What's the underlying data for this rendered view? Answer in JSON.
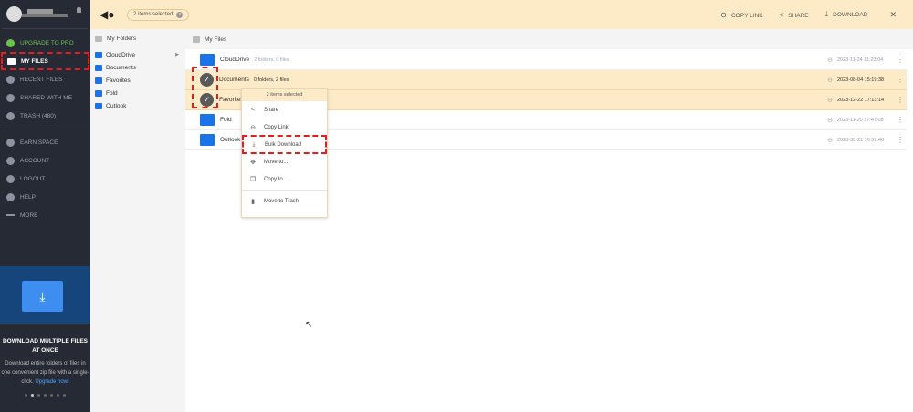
{
  "sidebar": {
    "nav": [
      {
        "label": "UPGRADE TO PRO",
        "icon": "pro-badge-icon"
      },
      {
        "label": "MY FILES",
        "icon": "folder-icon"
      },
      {
        "label": "RECENT FILES",
        "icon": "clock-icon"
      },
      {
        "label": "SHARED WITH ME",
        "icon": "people-icon"
      },
      {
        "label": "TRASH (480)",
        "icon": "trash-icon"
      }
    ],
    "nav2": [
      {
        "label": "EARN SPACE",
        "icon": "plus-circle-icon"
      },
      {
        "label": "ACCOUNT",
        "icon": "gear-icon"
      },
      {
        "label": "LOGOUT",
        "icon": "logout-icon"
      },
      {
        "label": "HELP",
        "icon": "help-icon"
      },
      {
        "label": "MORE",
        "icon": "more-icon"
      }
    ],
    "promo": {
      "title": "DOWNLOAD MULTIPLE FILES AT ONCE",
      "text": "Download entire folders of files in one convenient zip file with a single-click.",
      "link": "Upgrade now!",
      "slide_index": 2,
      "slide_count": 7
    }
  },
  "topbar": {
    "selected": "2 items selected",
    "copy_link": "COPY LINK",
    "share": "SHARE",
    "download": "DOWNLOAD",
    "close": "✕"
  },
  "folders": {
    "title": "My Folders",
    "items": [
      "CloudDrive",
      "Documents",
      "Favorites",
      "Fold",
      "Outlook"
    ]
  },
  "main": {
    "breadcrumb": "My Files",
    "rows": [
      {
        "name": "CloudDrive",
        "meta": "2 folders, 0 files",
        "date": "2023-11-24 11:23:04",
        "selected": false
      },
      {
        "name": "Documents",
        "meta": "0 folders, 2 files",
        "date": "2023-08-04 15:19:38",
        "selected": true
      },
      {
        "name": "Favorites",
        "meta": "",
        "date": "2023-12-22 17:13:14",
        "selected": true
      },
      {
        "name": "Fold",
        "meta": "",
        "date": "2023-11-20 17:47:08",
        "selected": false
      },
      {
        "name": "Outlook",
        "meta": "",
        "date": "2023-08-21 16:57:46",
        "selected": false
      }
    ]
  },
  "context_menu": {
    "header": "2 items selected",
    "items": [
      "Share",
      "Copy Link",
      "Bulk Download",
      "Move to...",
      "Copy to...",
      "Move to Trash"
    ]
  }
}
